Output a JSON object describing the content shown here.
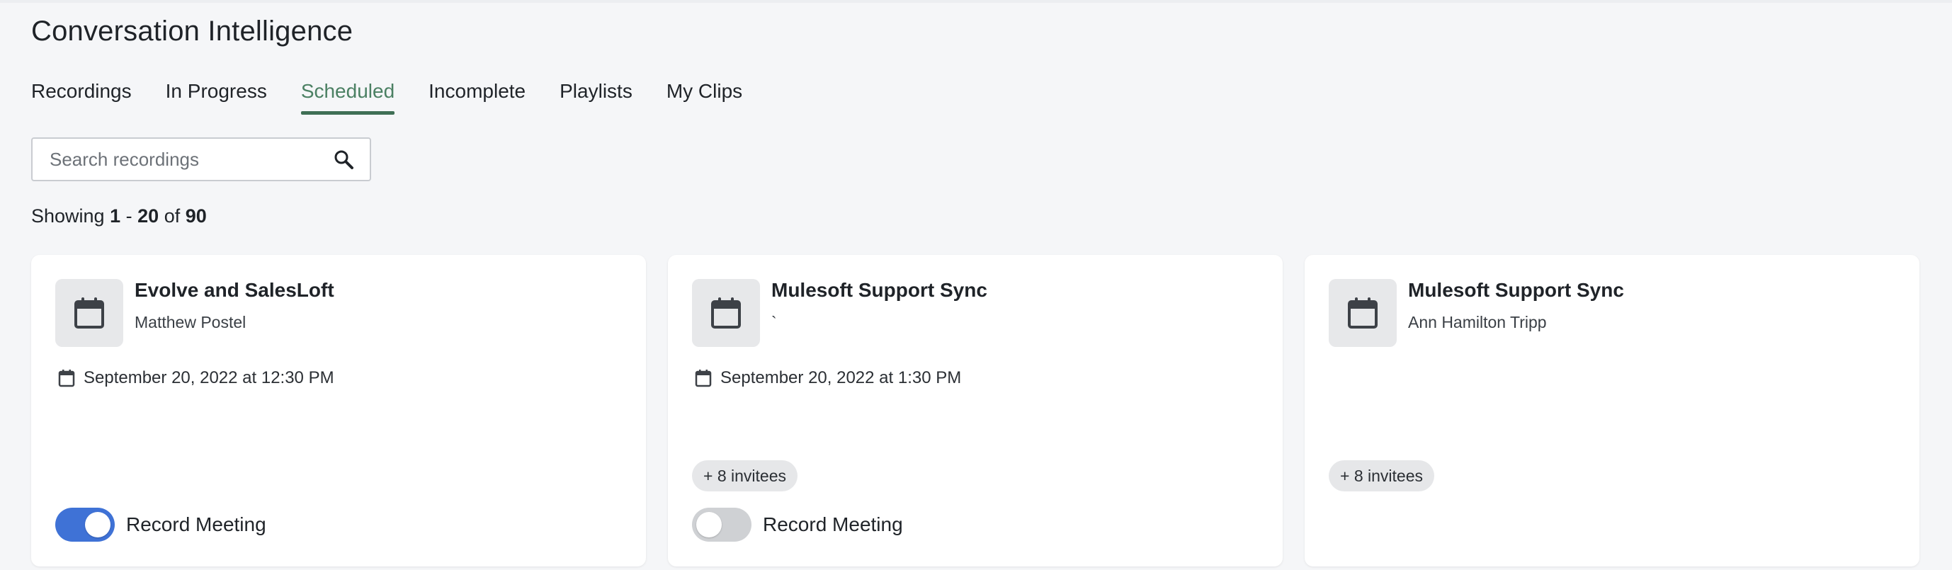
{
  "page": {
    "title": "Conversation Intelligence"
  },
  "tabs": [
    {
      "label": "Recordings",
      "active": false
    },
    {
      "label": "In Progress",
      "active": false
    },
    {
      "label": "Scheduled",
      "active": true
    },
    {
      "label": "Incomplete",
      "active": false
    },
    {
      "label": "Playlists",
      "active": false
    },
    {
      "label": "My Clips",
      "active": false
    }
  ],
  "search": {
    "placeholder": "Search recordings",
    "value": "",
    "icon": "search-icon"
  },
  "results": {
    "prefix": "Showing",
    "from": "1",
    "dash": "-",
    "to": "20",
    "of": "of",
    "total": "90"
  },
  "colors": {
    "accent": "#3f6f55",
    "active_tab_text": "#4b8063",
    "toggle_on": "#3f72d6",
    "toggle_off": "#cfd1d4"
  },
  "cards": [
    {
      "title": "Evolve and SalesLoft",
      "subtitle": "Matthew Postel",
      "date": "September 20, 2022 at 12:30 PM",
      "invitees": "",
      "record_label": "Record Meeting",
      "record_on": true,
      "icon": "calendar-icon"
    },
    {
      "title": "Mulesoft Support Sync",
      "subtitle": "`",
      "date": "September 20, 2022 at 1:30 PM",
      "invitees": "+ 8 invitees",
      "record_label": "Record Meeting",
      "record_on": false,
      "icon": "calendar-icon"
    },
    {
      "title": "Mulesoft Support Sync",
      "subtitle": "Ann Hamilton Tripp",
      "date": "",
      "invitees": "+ 8 invitees",
      "record_label": "",
      "record_on": null,
      "icon": "calendar-icon"
    }
  ]
}
